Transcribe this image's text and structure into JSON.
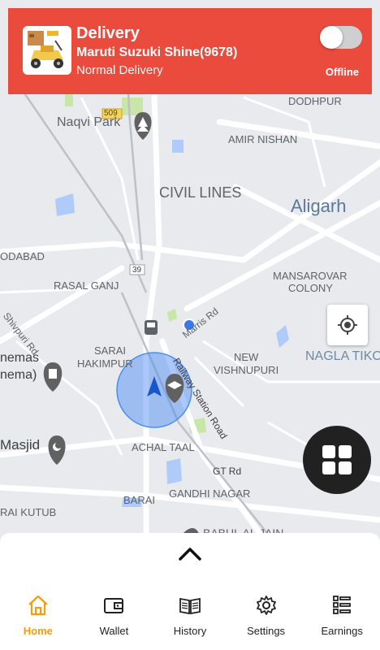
{
  "header": {
    "title": "Delivery",
    "vehicle": "Maruti Suzuki Shine(9678)",
    "delivery_type": "Normal Delivery",
    "status_label": "Offline",
    "online": false,
    "color": "#ea4b3c"
  },
  "map": {
    "labels": {
      "dodhpur": "DODHPUR",
      "naqvi_park": "Naqvi Park",
      "amir_nishan": "AMIR NISHAN",
      "civil_lines": "CIVIL LINES",
      "aligarh": "Aligarh",
      "odabad": "ODABAD",
      "rasal_ganj": "RASAL GANJ",
      "mansarovar": "MANSAROVAR",
      "colony": "COLONY",
      "shivpuri_rd": "Shivpuri Rd",
      "marris_rd": "Marris Rd",
      "nagla_tik": "NAGLA TIKO",
      "sarai": "SARAI",
      "hakimpur": "HAKIMPUR",
      "new": "NEW",
      "vishnupuri": "VISHNUPURI",
      "cinemas": "nemas",
      "cinema": "nema)",
      "railway_station_rd": "Railway Station Road",
      "masjid": "Masjid",
      "achal_taal": "ACHAL TAAL",
      "gt_rd": "GT Rd",
      "barai": "BARAI",
      "gandhi_nagar": "GANDHI NAGAR",
      "rai_kutub": "RAI KUTUB",
      "babul_al_jain": "BABUL AL JAIN",
      "route_509": "509",
      "route_39": "39"
    },
    "icons": [
      "tree-icon",
      "train-icon",
      "film-icon",
      "crescent-icon",
      "school-icon",
      "current-location-dot",
      "navigation-arrow-icon"
    ]
  },
  "controls": {
    "locate_icon": "crosshair-icon",
    "menu_icon": "grid-icon",
    "expand_icon": "chevron-up-icon"
  },
  "nav": {
    "items": [
      {
        "label": "Home",
        "icon": "home-icon",
        "active": true
      },
      {
        "label": "Wallet",
        "icon": "wallet-icon",
        "active": false
      },
      {
        "label": "History",
        "icon": "book-icon",
        "active": false
      },
      {
        "label": "Settings",
        "icon": "gear-icon",
        "active": false
      },
      {
        "label": "Earnings",
        "icon": "list-icon",
        "active": false
      }
    ],
    "active_color": "#f59d0e"
  }
}
